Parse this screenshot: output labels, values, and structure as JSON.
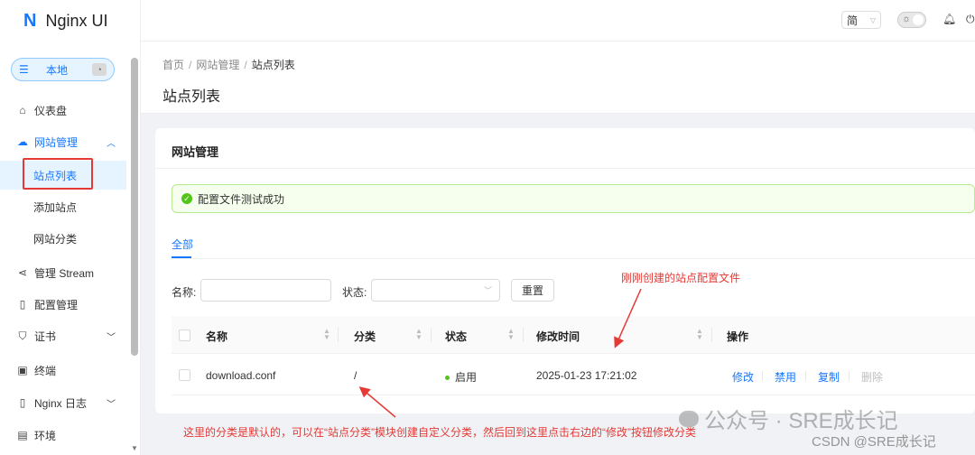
{
  "app": {
    "logo_mark": "N",
    "name": "Nginx UI"
  },
  "env": {
    "label": "本地",
    "icon": "list-icon"
  },
  "sidebar": {
    "items": [
      {
        "label": "仪表盘",
        "icon": "home-icon"
      },
      {
        "label": "网站管理",
        "icon": "cloud-icon",
        "expanded": true
      },
      {
        "label": "站点列表",
        "sub": true,
        "selected": true
      },
      {
        "label": "添加站点",
        "sub": true
      },
      {
        "label": "网站分类",
        "sub": true
      },
      {
        "label": "管理 Stream",
        "icon": "share-icon"
      },
      {
        "label": "配置管理",
        "icon": "file-icon"
      },
      {
        "label": "证书",
        "icon": "shield-icon"
      },
      {
        "label": "终端",
        "icon": "terminal-icon"
      },
      {
        "label": "Nginx 日志",
        "icon": "file-icon"
      },
      {
        "label": "环境",
        "icon": "server-icon"
      }
    ]
  },
  "header": {
    "lang": "简"
  },
  "breadcrumb": [
    "首页",
    "网站管理",
    "站点列表"
  ],
  "page": {
    "title": "站点列表"
  },
  "card": {
    "title": "网站管理",
    "alert": "配置文件测试成功",
    "tab_all": "全部",
    "filter": {
      "name_label": "名称:",
      "status_label": "状态:",
      "reset": "重置"
    }
  },
  "table": {
    "columns": [
      "名称",
      "分类",
      "状态",
      "修改时间",
      "操作"
    ],
    "rows": [
      {
        "name": "download.conf",
        "category": "/",
        "status": "启用",
        "modified": "2025-01-23 17:21:02",
        "actions": [
          "修改",
          "禁用",
          "复制",
          "删除"
        ]
      }
    ]
  },
  "annotations": {
    "top": "刚刚创建的站点配置文件",
    "bottom": "这里的分类是默认的，可以在“站点分类”模块创建自定义分类，然后回到这里点击右边的“修改”按钮修改分类"
  },
  "watermark": {
    "line1": "公众号 · SRE成长记",
    "line2": "CSDN @SRE成长记"
  },
  "colors": {
    "accent": "#1677ff",
    "success": "#52c41a",
    "annotation": "#e53935"
  }
}
